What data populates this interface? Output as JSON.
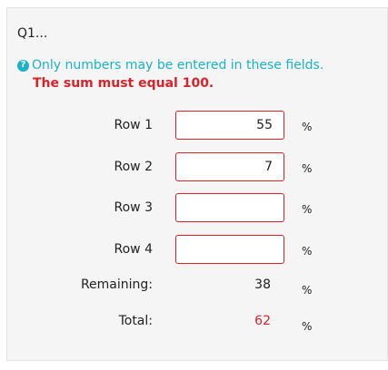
{
  "question": {
    "title": "Q1..."
  },
  "tip": {
    "icon": "question-circle-icon",
    "text": "Only numbers may be entered in these fields.",
    "color": "#1ab3c8"
  },
  "validation": {
    "message": "The sum must equal 100.",
    "color": "#d8232a"
  },
  "rows": [
    {
      "label": "Row 1",
      "value": "55",
      "unit": "%"
    },
    {
      "label": "Row 2",
      "value": "7",
      "unit": "%"
    },
    {
      "label": "Row 3",
      "value": "",
      "unit": "%"
    },
    {
      "label": "Row 4",
      "value": "",
      "unit": "%"
    }
  ],
  "summary": {
    "remaining_label": "Remaining:",
    "remaining_value": "38",
    "remaining_unit": "%",
    "total_label": "Total:",
    "total_value": "62",
    "total_unit": "%"
  }
}
